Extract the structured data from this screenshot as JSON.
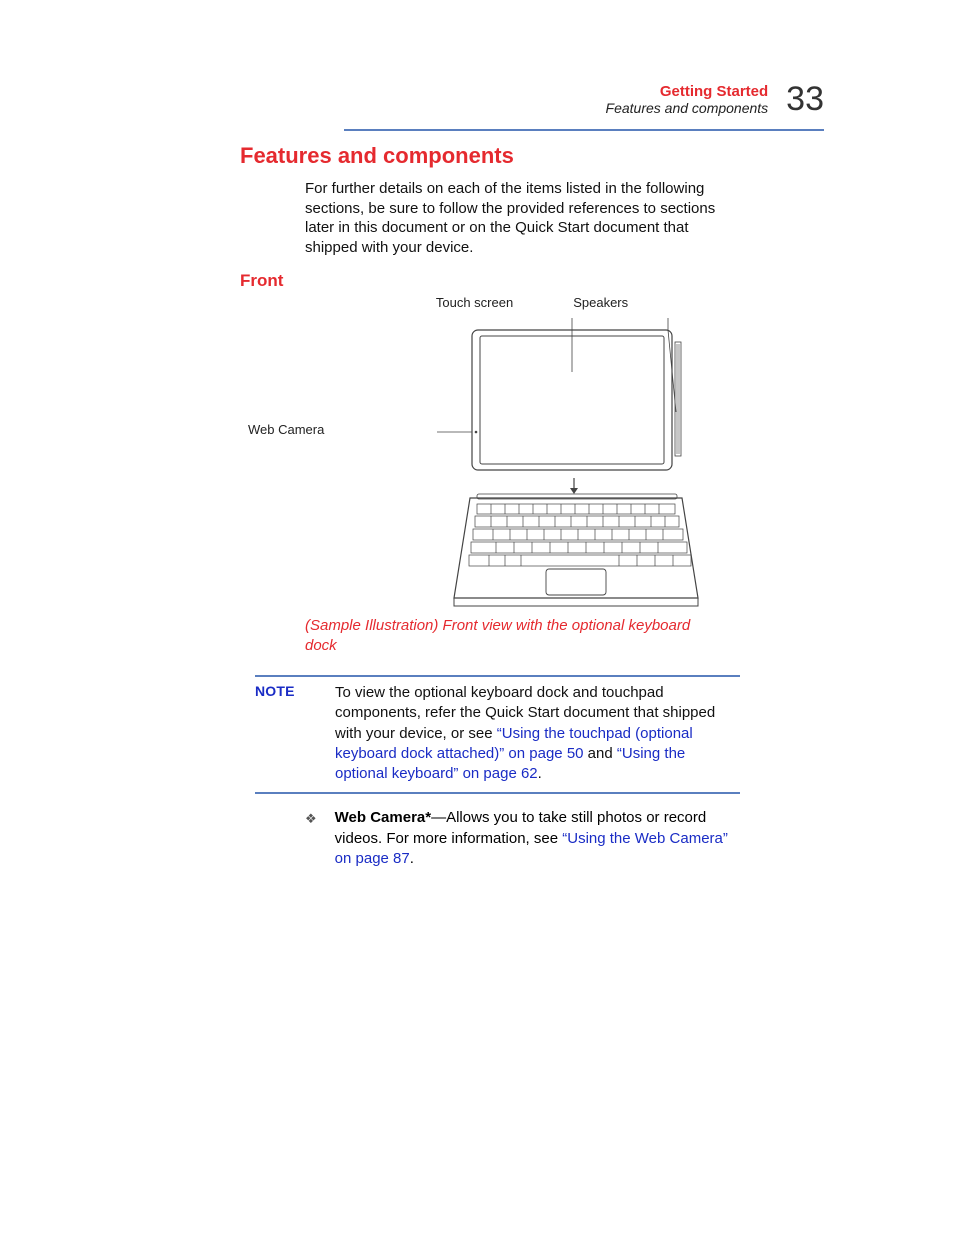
{
  "header": {
    "chapter": "Getting Started",
    "section": "Features and components",
    "page_number": "33"
  },
  "heading": "Features and components",
  "intro": "For further details on each of the items listed in the following sections, be sure to follow the provided references to sections later in this document or on the Quick Start document that shipped with your device.",
  "subhead": "Front",
  "figure": {
    "label_touchscreen": "Touch screen",
    "label_speakers": "Speakers",
    "label_webcam": "Web Camera",
    "caption": "(Sample Illustration) Front view with the optional keyboard dock"
  },
  "note": {
    "label": "NOTE",
    "text_before": "To view the optional keyboard dock and touchpad components, refer the Quick Start document that shipped with your device, or see ",
    "link1": "“Using the touchpad (optional keyboard dock attached)” on page 50",
    "mid": " and ",
    "link2": "“Using the optional keyboard” on page 62",
    "tail": "."
  },
  "bullet": {
    "term": "Web Camera*",
    "sep": "—",
    "text": "Allows you to take still photos or record videos. For more information, see ",
    "link": "“Using the Web Camera” on page 87",
    "tail": "."
  }
}
